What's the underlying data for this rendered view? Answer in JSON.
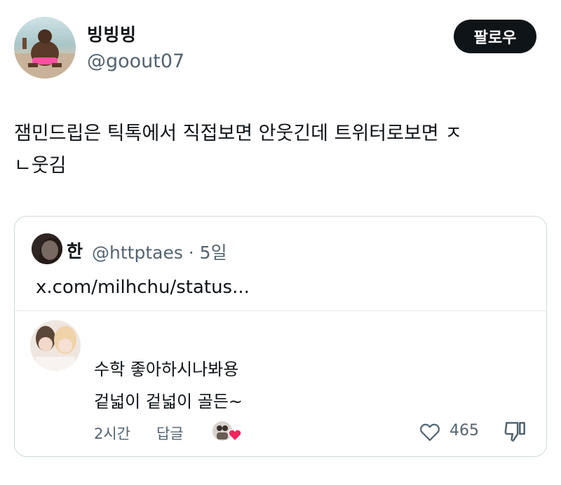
{
  "author": {
    "display_name": "빙빙빙",
    "handle": "@goout07",
    "avatar_icon": "profile-photo-icon"
  },
  "follow_button": {
    "label": "팔로우"
  },
  "tweet": {
    "lines": [
      "잼민드립은 틱톡에서 직접보면 안웃긴데 트위터로보면 ㅈ",
      "ㄴ웃김"
    ]
  },
  "quote": {
    "name": "한",
    "handle_time": "@httptaes · 5일",
    "link": "x.com/milhchu/status...",
    "comment": {
      "line1": "수학 좋아하시나봐용",
      "line2": "겉넓이 겉넓이 골든~",
      "time": "2시간",
      "reply_label": "답글",
      "like_count": "465"
    }
  },
  "colors": {
    "text": "#0f1419",
    "muted": "#536471",
    "border": "#cfd9de",
    "button": "#0f1419",
    "heart": "#f4245e"
  }
}
